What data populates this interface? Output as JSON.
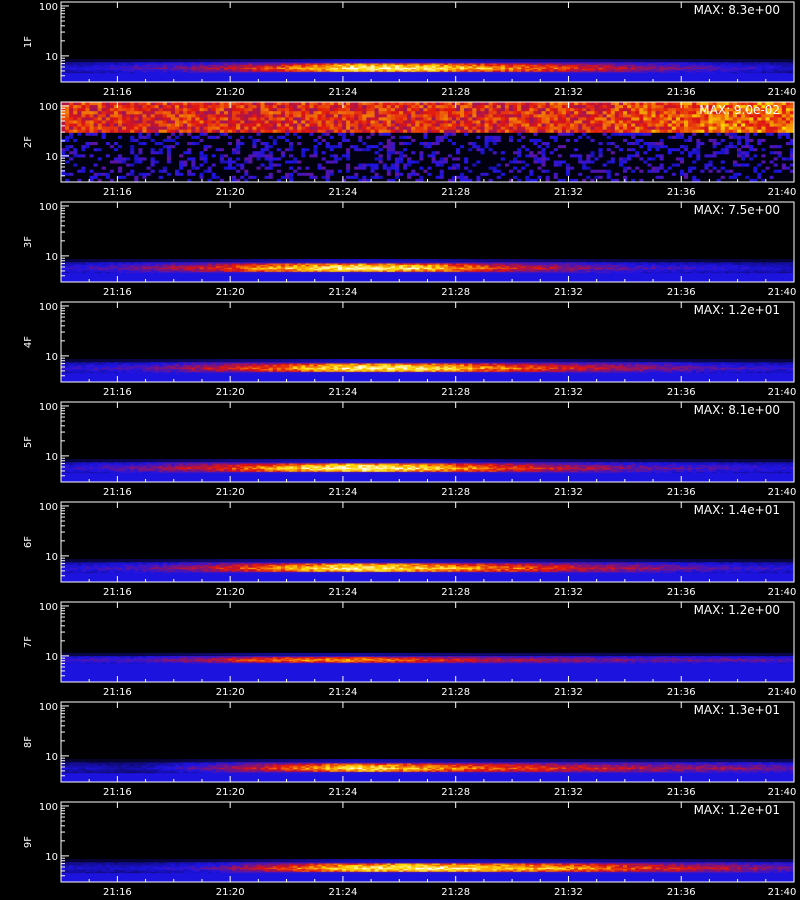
{
  "chart_data": {
    "type": "heatmap",
    "colormap": "black-blue-red-yellow-white",
    "xlabel": "",
    "x_ticks": [
      "21:16",
      "21:20",
      "21:24",
      "21:28",
      "21:32",
      "21:36",
      "21:40"
    ],
    "x_tick_minutes": [
      16,
      20,
      24,
      28,
      32,
      36,
      40
    ],
    "x_range_minutes": [
      14,
      40
    ],
    "y_scale": "log",
    "y_ticks": [
      "10",
      "100"
    ],
    "y_tick_values": [
      10,
      100
    ],
    "y_range": [
      3,
      120
    ],
    "panels": [
      {
        "name": "1F",
        "max_label": "MAX: 8.3e+00",
        "band": [
          4.5,
          7.5
        ],
        "pattern": "band",
        "intensity": [
          0.25,
          0.35,
          0.45,
          0.65,
          0.95,
          0.9,
          0.75,
          0.6,
          0.45,
          0.35,
          0.25
        ]
      },
      {
        "name": "2F",
        "max_label": "MAX: 9.0e-02",
        "band": [
          30,
          100
        ],
        "pattern": "noise",
        "intensity": [
          0.6,
          0.6,
          0.6,
          0.6,
          0.6,
          0.6,
          0.6,
          0.6,
          0.65,
          0.7,
          0.7
        ]
      },
      {
        "name": "3F",
        "max_label": "MAX: 7.5e+00",
        "band": [
          4.5,
          7.5
        ],
        "pattern": "band",
        "intensity": [
          0.3,
          0.4,
          0.55,
          0.8,
          0.95,
          0.85,
          0.6,
          0.45,
          0.35,
          0.3,
          0.25
        ]
      },
      {
        "name": "4F",
        "max_label": "MAX: 1.2e+01",
        "band": [
          4.5,
          7.5
        ],
        "pattern": "band",
        "intensity": [
          0.3,
          0.35,
          0.5,
          0.7,
          0.95,
          0.9,
          0.7,
          0.55,
          0.45,
          0.35,
          0.3
        ]
      },
      {
        "name": "5F",
        "max_label": "MAX: 8.1e+00",
        "band": [
          4.5,
          7.5
        ],
        "pattern": "band",
        "intensity": [
          0.3,
          0.4,
          0.55,
          0.8,
          1.0,
          0.85,
          0.65,
          0.5,
          0.4,
          0.35,
          0.3
        ]
      },
      {
        "name": "6F",
        "max_label": "MAX: 1.4e+01",
        "band": [
          4.5,
          7.5
        ],
        "pattern": "band",
        "intensity": [
          0.3,
          0.35,
          0.5,
          0.75,
          0.95,
          0.85,
          0.7,
          0.55,
          0.45,
          0.35,
          0.3
        ]
      },
      {
        "name": "7F",
        "max_label": "MAX: 1.2e+00",
        "band": [
          7,
          10
        ],
        "pattern": "band-noise",
        "intensity": [
          0.35,
          0.35,
          0.5,
          0.7,
          0.75,
          0.6,
          0.5,
          0.45,
          0.4,
          0.4,
          0.35
        ]
      },
      {
        "name": "8F",
        "max_label": "MAX: 1.3e+01",
        "band": [
          4.5,
          7.5
        ],
        "pattern": "band",
        "intensity": [
          0.25,
          0.2,
          0.4,
          0.6,
          0.9,
          0.75,
          0.65,
          0.55,
          0.5,
          0.45,
          0.4
        ]
      },
      {
        "name": "9F",
        "max_label": "MAX: 1.2e+01",
        "band": [
          4.5,
          7.5
        ],
        "pattern": "band",
        "intensity": [
          0.25,
          0.25,
          0.35,
          0.6,
          0.9,
          0.95,
          0.85,
          0.75,
          0.6,
          0.5,
          0.4
        ]
      }
    ]
  }
}
